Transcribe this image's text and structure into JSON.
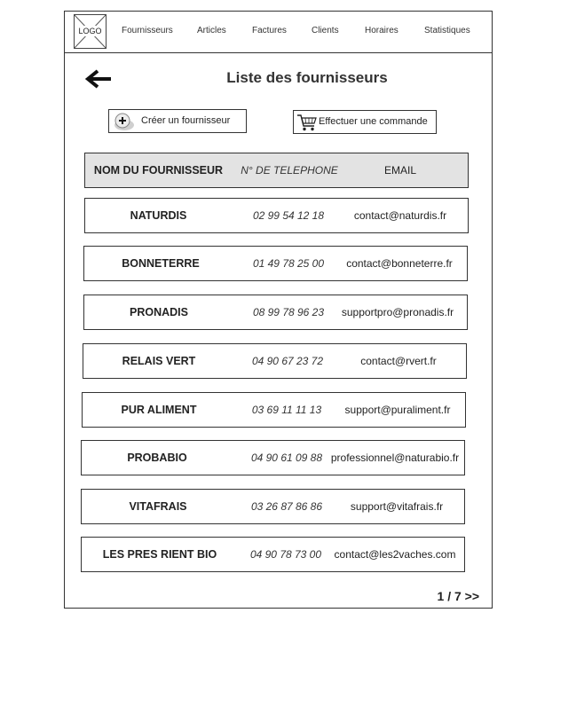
{
  "logo": {
    "text": "LOGO"
  },
  "nav": [
    {
      "label": "Fournisseurs"
    },
    {
      "label": "Articles"
    },
    {
      "label": "Factures"
    },
    {
      "label": "Clients"
    },
    {
      "label": "Horaires"
    },
    {
      "label": "Statistiques"
    }
  ],
  "page_title": "Liste des fournisseurs",
  "actions": {
    "create_label": "Créer un fournisseur",
    "order_label": "Effectuer une commande"
  },
  "table": {
    "headers": {
      "name": "NOM DU FOURNISSEUR",
      "phone": "N° DE TELEPHONE",
      "email": "EMAIL"
    },
    "rows": [
      {
        "name": "NATURDIS",
        "phone": "02 99 54 12 18",
        "email": "contact@naturdis.fr"
      },
      {
        "name": "BONNETERRE",
        "phone": "01 49 78 25 00",
        "email": "contact@bonneterre.fr"
      },
      {
        "name": "PRONADIS",
        "phone": "08 99 78 96 23",
        "email": "supportpro@pronadis.fr"
      },
      {
        "name": "RELAIS VERT",
        "phone": "04 90 67 23 72",
        "email": "contact@rvert.fr"
      },
      {
        "name": "PUR ALIMENT",
        "phone": "03 69 11 11 13",
        "email": "support@puraliment.fr"
      },
      {
        "name": "PROBABIO",
        "phone": "04 90 61 09 88",
        "email": "professionnel@naturabio.fr"
      },
      {
        "name": "VITAFRAIS",
        "phone": "03 26 87 86 86",
        "email": "support@vitafrais.fr"
      },
      {
        "name": "LES PRES RIENT BIO",
        "phone": "04 90 78 73 00",
        "email": "contact@les2vaches.com"
      }
    ]
  },
  "pagination": {
    "label": "1 / 7 >>"
  },
  "icons": {
    "back": "arrow-left-icon",
    "create": "plus-circle-icon",
    "order": "shopping-cart-icon",
    "logo": "logo-placeholder-icon"
  }
}
